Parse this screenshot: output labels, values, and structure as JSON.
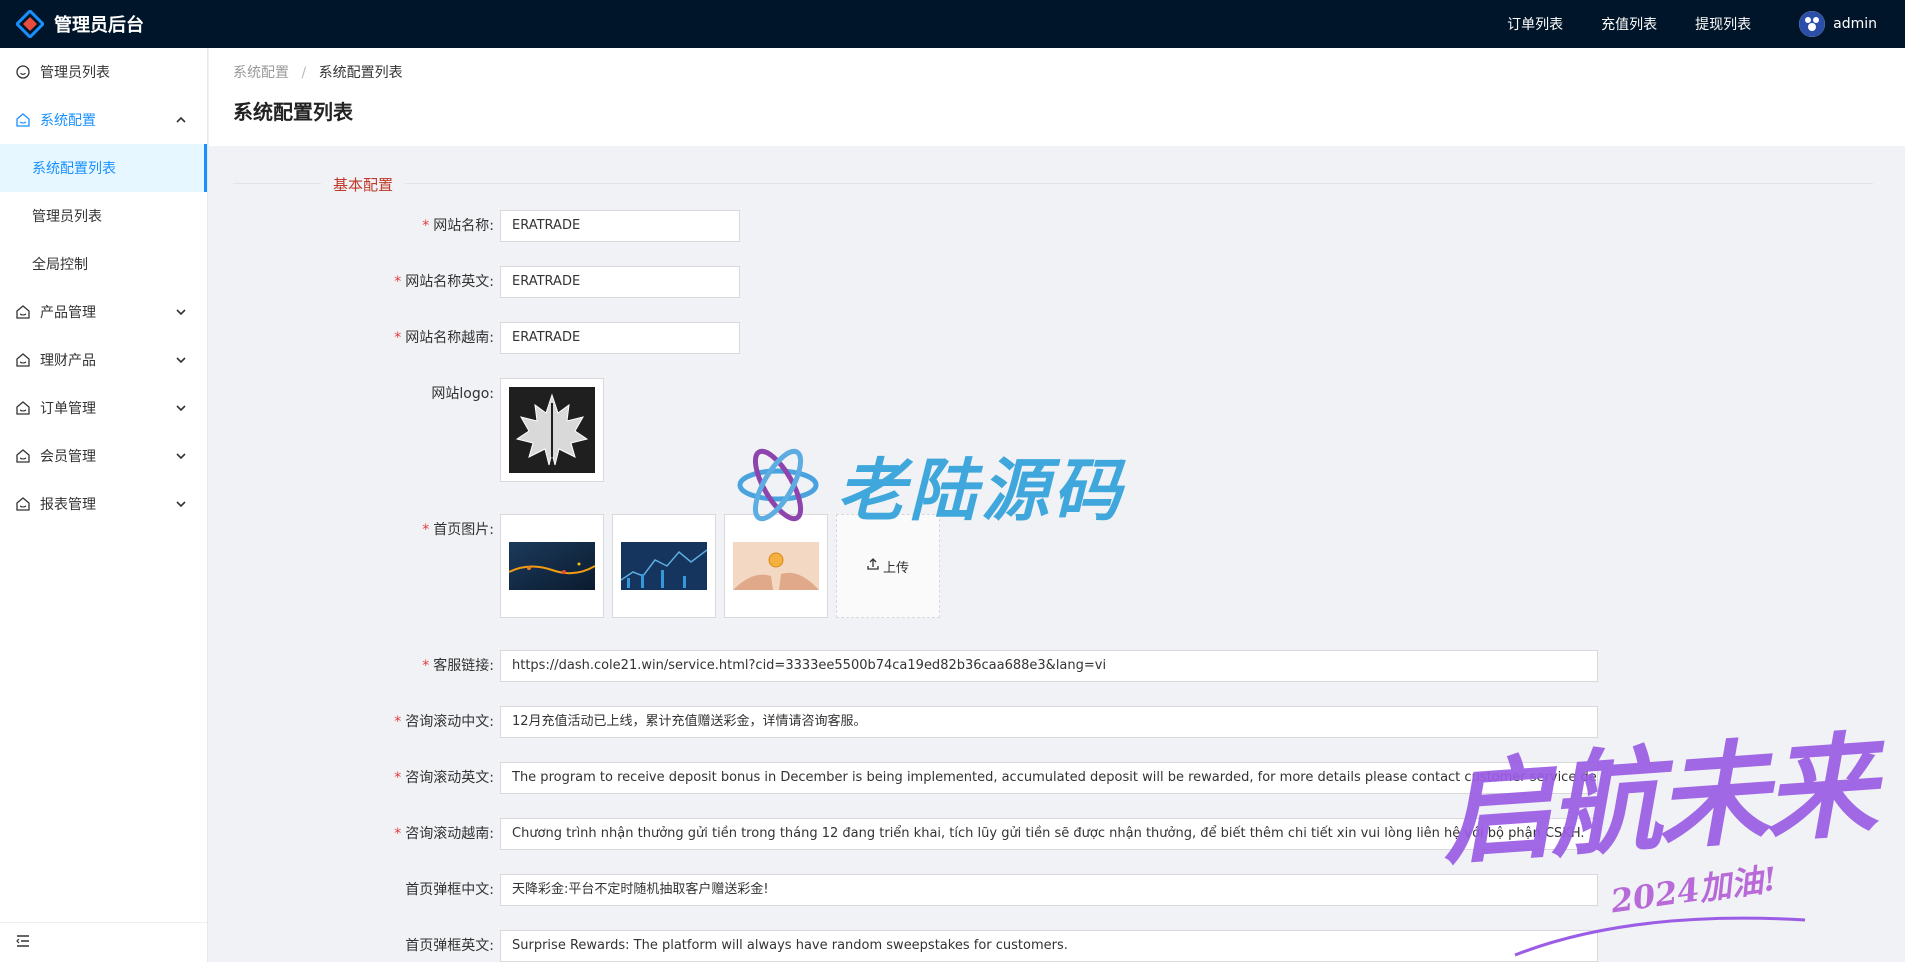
{
  "app": {
    "title": "管理员后台"
  },
  "topnav": {
    "links": [
      "订单列表",
      "充值列表",
      "提现列表"
    ],
    "user": "admin"
  },
  "sidebar": {
    "items": [
      {
        "label": "管理员列表",
        "icon": "smile-icon"
      },
      {
        "label": "系统配置",
        "icon": "house-icon",
        "expanded": true,
        "children": [
          "系统配置列表",
          "管理员列表",
          "全局控制"
        ]
      },
      {
        "label": "产品管理",
        "icon": "house-icon"
      },
      {
        "label": "理财产品",
        "icon": "house-icon"
      },
      {
        "label": "订单管理",
        "icon": "house-icon"
      },
      {
        "label": "会员管理",
        "icon": "house-icon"
      },
      {
        "label": "报表管理",
        "icon": "house-icon"
      }
    ]
  },
  "breadcrumb": {
    "parent": "系统配置",
    "current": "系统配置列表"
  },
  "page": {
    "title": "系统配置列表"
  },
  "form": {
    "section_title": "基本配置",
    "site_name": {
      "label": "网站名称:",
      "value": "ERATRADE"
    },
    "site_name_en": {
      "label": "网站名称英文:",
      "value": "ERATRADE"
    },
    "site_name_vi": {
      "label": "网站名称越南:",
      "value": "ERATRADE"
    },
    "site_logo": {
      "label": "网站logo:"
    },
    "home_images": {
      "label": "首页图片:",
      "upload_label": "上传"
    },
    "service_link": {
      "label": "客服链接:",
      "value": "https://dash.cole21.win/service.html?cid=3333ee5500b74ca19ed82b36caa688e3&lang=vi"
    },
    "scroll_zh": {
      "label": "咨询滚动中文:",
      "value": "12月充值活动已上线，累计充值赠送彩金，详情请咨询客服。"
    },
    "scroll_en": {
      "label": "咨询滚动英文:",
      "value": "The program to receive deposit bonus in December is being implemented, accumulated deposit will be rewarded, for more details please contact customer service department"
    },
    "scroll_vi": {
      "label": "咨询滚动越南:",
      "value": "Chương trình nhận thưởng gửi tiền trong tháng 12 đang triển khai, tích lũy gửi tiền sẽ được nhận thưởng, để biết thêm chi tiết xin vui lòng liên hệ với bộ phận CSKH."
    },
    "popup_zh": {
      "label": "首页弹框中文:",
      "value": "天降彩金:平台不定时随机抽取客户赠送彩金!"
    },
    "popup_en": {
      "label": "首页弹框英文:",
      "value": "Surprise Rewards: The platform will always have random sweepstakes for customers."
    }
  },
  "watermarks": {
    "center": "老陆源码",
    "corner_main": "启航未来",
    "corner_sub": "2024加油!"
  },
  "colors": {
    "header_bg": "#001529",
    "primary": "#1890ff",
    "section_title": "#c0392b",
    "required": "#e4393c"
  }
}
